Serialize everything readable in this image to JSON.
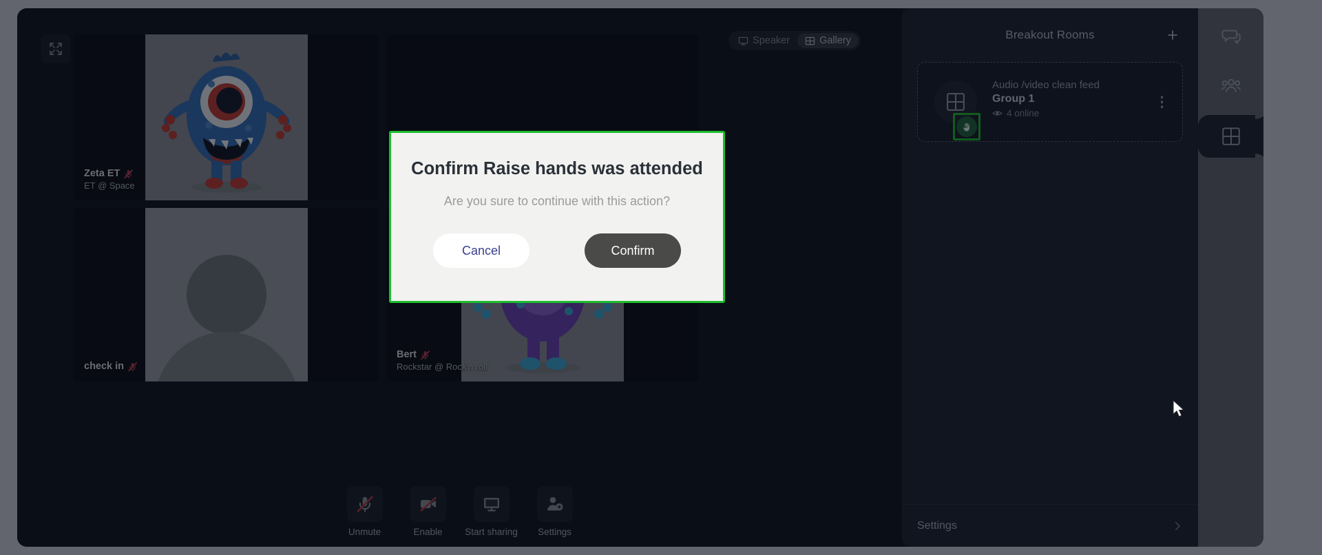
{
  "view_switch": {
    "speaker_label": "Speaker",
    "gallery_label": "Gallery",
    "active": "Gallery"
  },
  "tiles": [
    {
      "name": "Zeta ET",
      "subtitle": "ET @ Space",
      "muted": true,
      "avatar": "monster-blue"
    },
    {
      "name": "",
      "subtitle": "",
      "muted": false,
      "avatar": "none"
    },
    {
      "name": "check in",
      "subtitle": "",
      "muted": true,
      "avatar": "person-placeholder"
    },
    {
      "name": "Bert",
      "subtitle": "Rockstar @ Rock'n roll",
      "muted": true,
      "avatar": "monster-purple"
    }
  ],
  "toolbar": [
    {
      "label": "Unmute",
      "icon": "mic-off-icon"
    },
    {
      "label": "Enable",
      "icon": "video-off-icon"
    },
    {
      "label": "Start sharing",
      "icon": "monitor-icon"
    },
    {
      "label": "Settings",
      "icon": "person-gear-icon"
    }
  ],
  "sidebar": {
    "title": "Breakout Rooms",
    "add_label": "+",
    "room": {
      "feed_label": "Audio /video clean feed",
      "name": "Group 1",
      "online": "4 online",
      "hand_raised": true
    },
    "footer_label": "Settings"
  },
  "rail": [
    {
      "icon": "chat-icon",
      "active": false
    },
    {
      "icon": "people-icon",
      "active": false
    },
    {
      "icon": "grid-icon",
      "active": true
    }
  ],
  "modal": {
    "title": "Confirm Raise hands was attended",
    "subtitle": "Are you sure to continue with this action?",
    "cancel_label": "Cancel",
    "confirm_label": "Confirm"
  },
  "colors": {
    "highlight": "#1ebd2c",
    "confirm_bg": "#4a4a48",
    "cancel_text": "#3a3f8f",
    "mic_off": "#b0384a",
    "hand_badge": "#1e5f3a"
  }
}
